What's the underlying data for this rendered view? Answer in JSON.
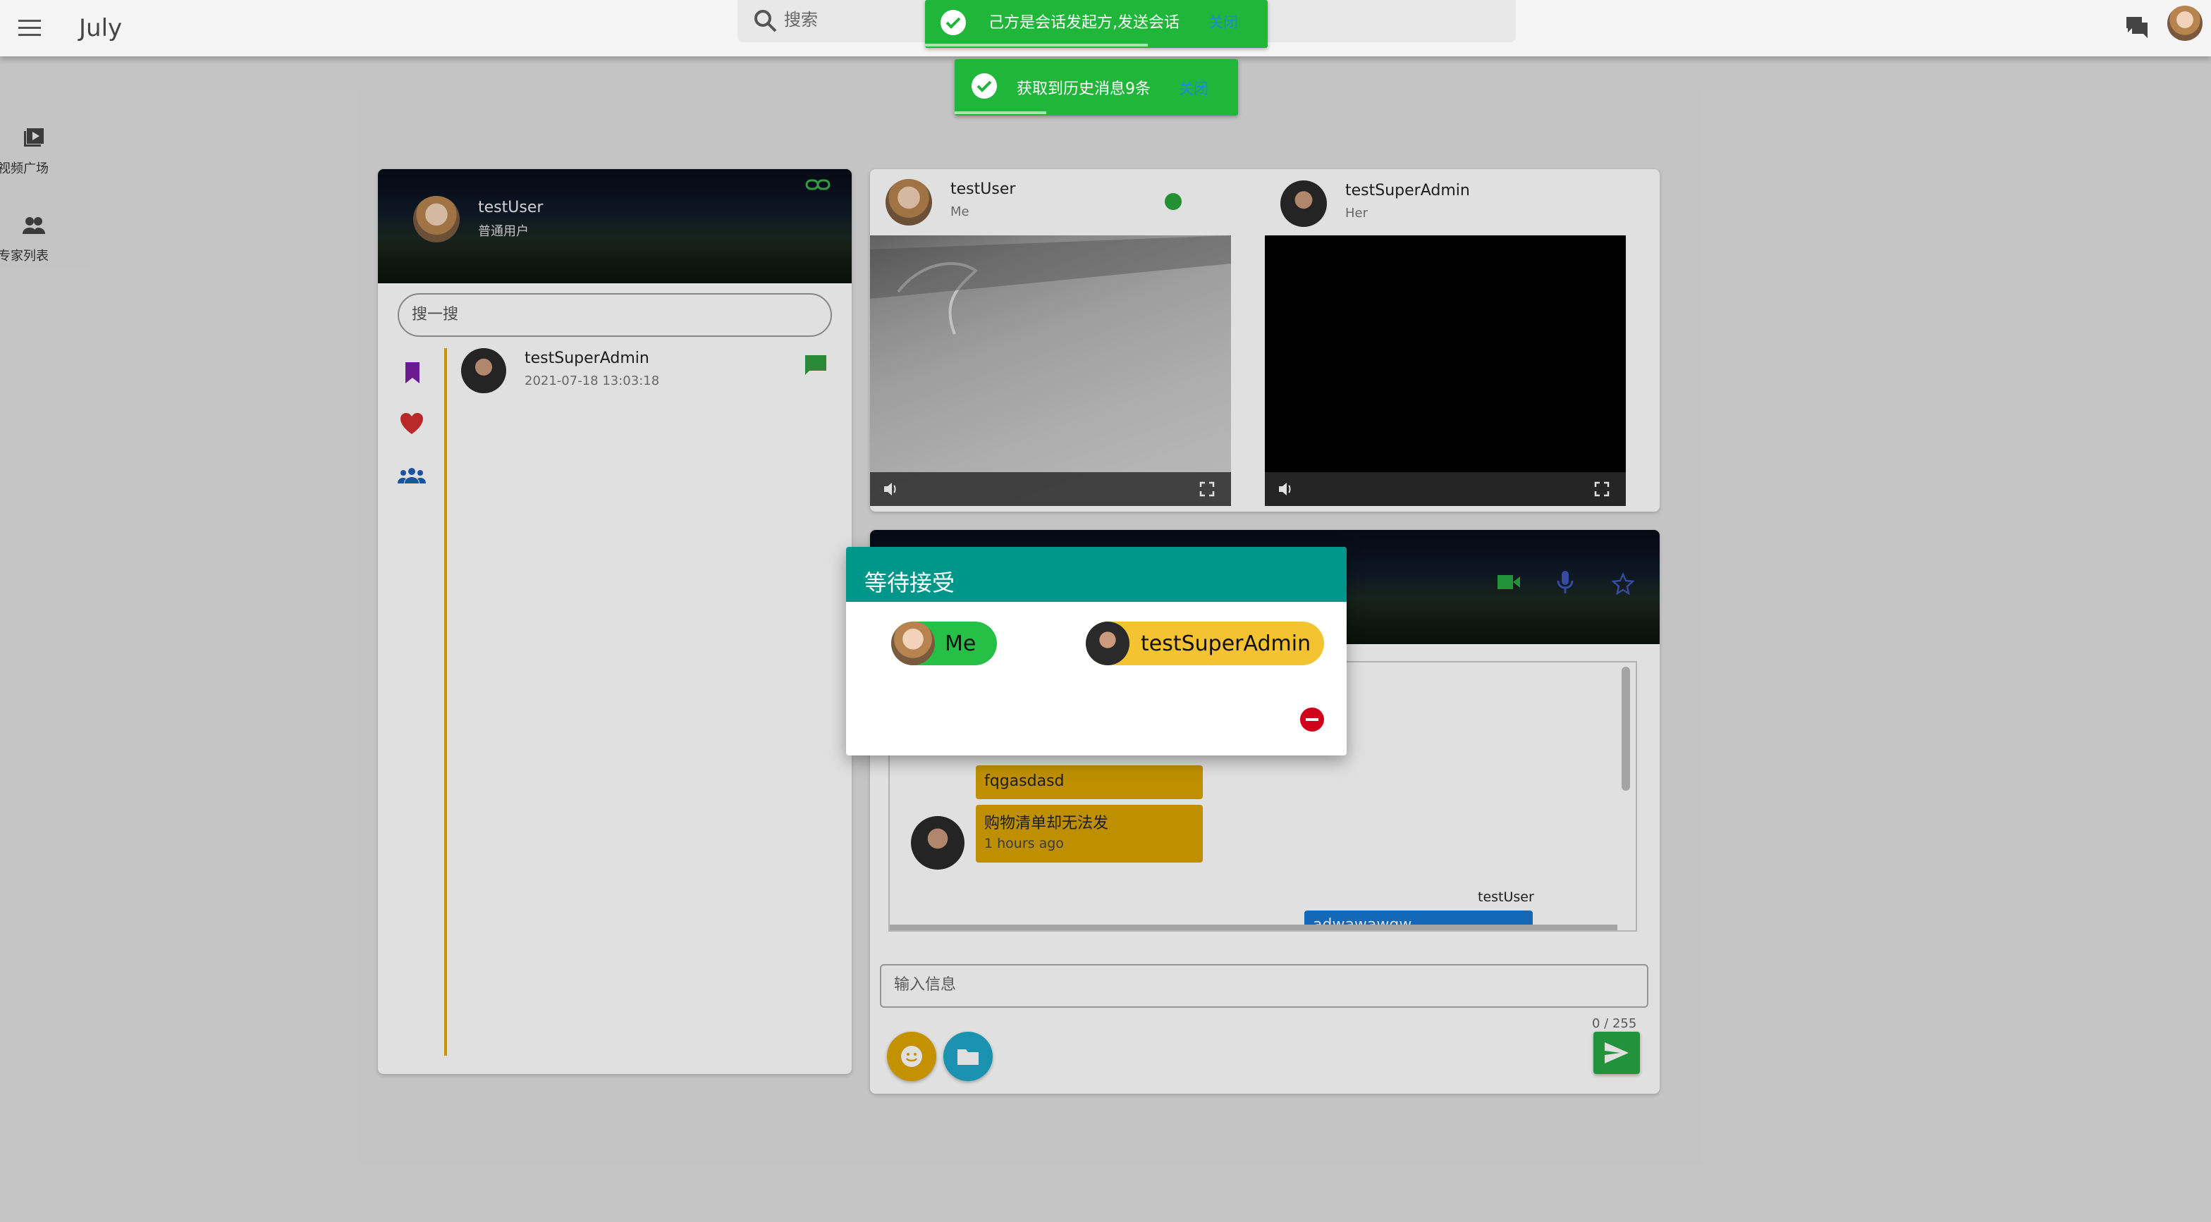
{
  "app": {
    "title": "July"
  },
  "search": {
    "placeholder": "搜索"
  },
  "nav": [
    {
      "label": "视频广场",
      "icon": "video-library-icon"
    },
    {
      "label": "专家列表",
      "icon": "people-icon"
    }
  ],
  "toasts": [
    {
      "text": "己方是会话发起方,发送会话",
      "close": "关闭"
    },
    {
      "text": "获取到历史消息9条",
      "close": "关闭"
    }
  ],
  "profile": {
    "name": "testUser",
    "role": "普通用户"
  },
  "contact_search": {
    "placeholder": "搜一搜"
  },
  "contacts": [
    {
      "name": "testSuperAdmin",
      "time": "2021-07-18 13:03:18"
    }
  ],
  "videos": [
    {
      "name": "testUser",
      "sub": "Me"
    },
    {
      "name": "testSuperAdmin",
      "sub": "Her"
    }
  ],
  "messages": [
    {
      "text": "fqgasdasd"
    },
    {
      "text": "购物清单却无法发",
      "time": "1 hours ago"
    },
    {
      "sender": "testUser",
      "text": "adwawawgw"
    }
  ],
  "composer": {
    "placeholder": "输入信息",
    "counter": "0 / 255"
  },
  "dialog": {
    "title": "等待接受",
    "from": "Me",
    "arrow": "»",
    "to": "testSuperAdmin"
  },
  "colors": {
    "accent_teal": "#00978a",
    "success": "#1fb63a",
    "chip_green": "#26c046",
    "chip_yellow": "#f3c331",
    "bubble_yellow": "#d9a300",
    "bubble_blue": "#1976d2"
  }
}
